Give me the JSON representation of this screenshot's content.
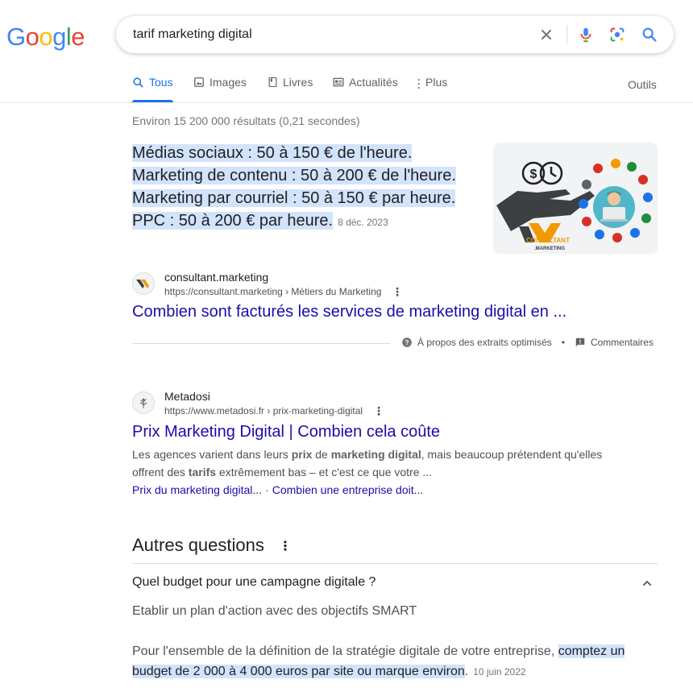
{
  "logo": {
    "letters": [
      "G",
      "o",
      "o",
      "g",
      "l",
      "e"
    ],
    "colors": [
      "#4285f4",
      "#ea4335",
      "#fbbc05",
      "#4285f4",
      "#34a853",
      "#ea4335"
    ]
  },
  "search": {
    "query": "tarif marketing digital"
  },
  "tabs": [
    {
      "label": "Tous",
      "icon": "search-icon",
      "active": true
    },
    {
      "label": "Images",
      "icon": "image-icon"
    },
    {
      "label": "Livres",
      "icon": "book-icon"
    },
    {
      "label": "Actualités",
      "icon": "news-icon"
    },
    {
      "label": "Plus",
      "icon": "more-vert-icon"
    }
  ],
  "tools_label": "Outils",
  "stats": "Environ 15 200 000 résultats (0,21 secondes)",
  "featured": {
    "lines": [
      "Médias sociaux : 50 à 150 € de l'heure.",
      "Marketing de contenu : 50 à 200 € de l'heure.",
      "Marketing par courriel : 50 à 150 € par heure.",
      "PPC : 50 à 200 € par heure."
    ],
    "date": "8 déc. 2023",
    "image_text": [
      "CONSULTANT",
      ".MARKETING"
    ],
    "source": {
      "site_name": "consultant.marketing",
      "url": "https://consultant.marketing › Métiers du Marketing",
      "title": "Combien sont facturés les services de marketing digital en ..."
    },
    "about_label": "À propos des extraits optimisés",
    "bullet": "•",
    "feedback_label": "Commentaires"
  },
  "result2": {
    "site_name": "Metadosi",
    "url": "https://www.metadosi.fr › prix-marketing-digital",
    "title": "Prix Marketing Digital | Combien cela coûte",
    "snippet_parts": [
      "Les agences varient dans leurs ",
      "prix",
      " de ",
      "marketing digital",
      ", mais beaucoup prétendent qu'elles offrent des ",
      "tarifs",
      " extrêmement bas – et c'est ce que votre ..."
    ],
    "sitelinks": [
      "Prix du marketing digital...",
      "Combien une entreprise doit..."
    ],
    "sitelink_sep": "·"
  },
  "paa": {
    "title": "Autres questions",
    "question": "Quel budget pour une campagne digitale ?",
    "answer_line1": "Etablir un plan d'action avec des objectifs SMART",
    "answer_prefix": "Pour l'ensemble de la définition de la stratégie digitale de votre entreprise, ",
    "answer_highlight": "comptez un budget de 2 000 à 4 000 euros par site ou marque environ",
    "answer_suffix": ".",
    "date": "10 juin 2022"
  }
}
